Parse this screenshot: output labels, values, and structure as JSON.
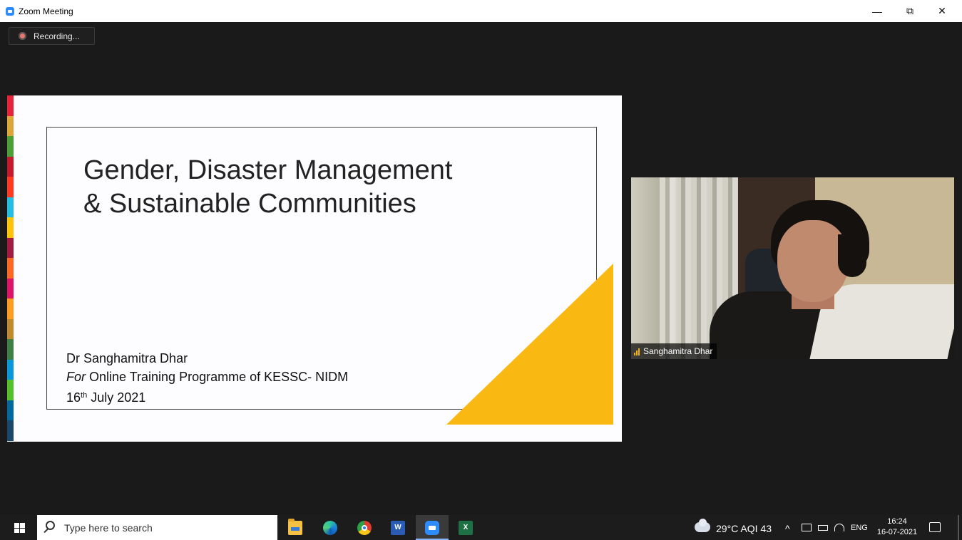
{
  "window": {
    "title": "Zoom Meeting",
    "minimize_glyph": "—",
    "restore_glyph": "⧉",
    "close_glyph": "✕"
  },
  "recording": {
    "label": "Recording..."
  },
  "slide": {
    "title_line1": "Gender, Disaster Management",
    "title_line2": "& Sustainable Communities",
    "presenter": "Dr Sanghamitra Dhar",
    "program_prefix": "For",
    "program_rest": " Online Training Programme of KESSC- NIDM",
    "date_day": "16",
    "date_suffix": "th",
    "date_rest": " July 2021",
    "sdg_colors": [
      "#e5243b",
      "#dda63a",
      "#4c9f38",
      "#c5192d",
      "#ff3a21",
      "#26bde2",
      "#fcc30b",
      "#a21942",
      "#fd6925",
      "#dd1367",
      "#fd9d24",
      "#bf8b2e",
      "#3f7e44",
      "#0a97d9",
      "#56c02b",
      "#00689d",
      "#19486a"
    ],
    "accent_color": "#f9b912"
  },
  "video": {
    "participant_name": "Sanghamitra Dhar"
  },
  "taskbar": {
    "search_placeholder": "Type here to search",
    "weather": "29°C  AQI 43",
    "language": "ENG",
    "time": "16:24",
    "date": "16-07-2021",
    "pinned_icons": [
      "file-explorer-icon",
      "edge-icon",
      "chrome-icon",
      "word-icon",
      "zoom-icon",
      "excel-icon"
    ]
  }
}
